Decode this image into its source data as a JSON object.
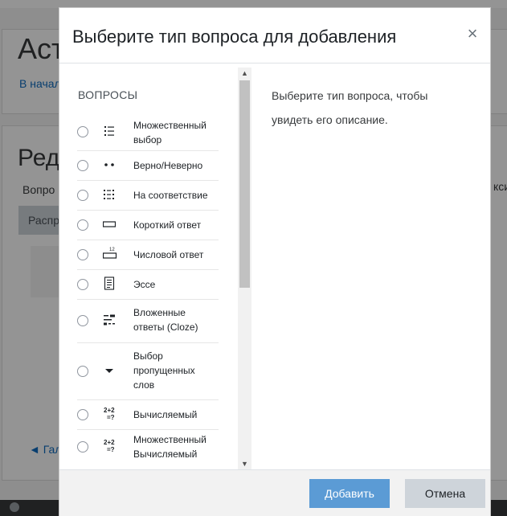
{
  "background": {
    "page_title_fragment": "Аст",
    "breadcrumb_fragment": "В начал",
    "edit_title_fragment": "Ред",
    "questions_label_fragment": "Вопро",
    "right_fragment": "кси",
    "button_fragment": "Распр",
    "gallery_link_fragment": "◄ Гал"
  },
  "modal": {
    "title": "Выберите тип вопроса для добавления",
    "close_glyph": "×",
    "section_label": "ВОПРОСЫ",
    "description": "Выберите тип вопроса, чтобы увидеть его описание.",
    "question_types": [
      {
        "label": "Множественный выбор",
        "icon": "multichoice-icon"
      },
      {
        "label": "Верно/Неверно",
        "icon": "truefalse-icon"
      },
      {
        "label": "На соответствие",
        "icon": "match-icon"
      },
      {
        "label": "Короткий ответ",
        "icon": "shortanswer-icon"
      },
      {
        "label": "Числовой ответ",
        "icon": "numerical-icon"
      },
      {
        "label": "Эссе",
        "icon": "essay-icon"
      },
      {
        "label": "Вложенные ответы (Cloze)",
        "icon": "cloze-icon"
      },
      {
        "label": "Выбор пропущенных слов",
        "icon": "gapselect-icon"
      },
      {
        "label": "Вычисляемый",
        "icon": "calculated-icon"
      },
      {
        "label": "Множественный Вычисляемый",
        "icon": "calculatedmulti-icon"
      }
    ],
    "calc_icon_text_top": "2+2",
    "calc_icon_text_bottom": "=?",
    "numerical_icon_text": "12",
    "add_button": "Добавить",
    "cancel_button": "Отмена"
  },
  "colors": {
    "primary_button": "#5b9bd5",
    "secondary_button": "#ced4da",
    "link": "#0f6cbf"
  }
}
